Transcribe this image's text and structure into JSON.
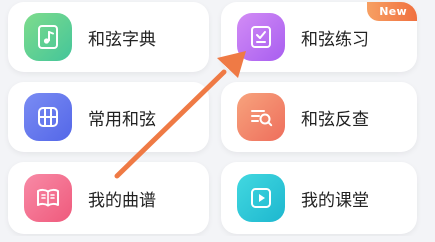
{
  "grid": {
    "items": [
      {
        "label": "和弦字典",
        "icon": "music-file-icon",
        "gradient": [
          "#7edc8c",
          "#44c59a"
        ]
      },
      {
        "label": "和弦练习",
        "icon": "practice-checklist-icon",
        "gradient": [
          "#d28cf5",
          "#a85ef0"
        ],
        "badge": "New",
        "badge_color": "#f28a52"
      },
      {
        "label": "常用和弦",
        "icon": "fretboard-icon",
        "gradient": [
          "#7a8cf3",
          "#5467e8"
        ]
      },
      {
        "label": "和弦反查",
        "icon": "search-list-icon",
        "gradient": [
          "#f7a37d",
          "#ee6e5c"
        ]
      },
      {
        "label": "我的曲谱",
        "icon": "sheet-book-icon",
        "gradient": [
          "#f88aa6",
          "#ef5a7c"
        ]
      },
      {
        "label": "我的课堂",
        "icon": "video-play-icon",
        "gradient": [
          "#42d8e0",
          "#1db7cf"
        ]
      }
    ]
  },
  "annotation": {
    "type": "arrow",
    "color": "#ef7a45"
  }
}
